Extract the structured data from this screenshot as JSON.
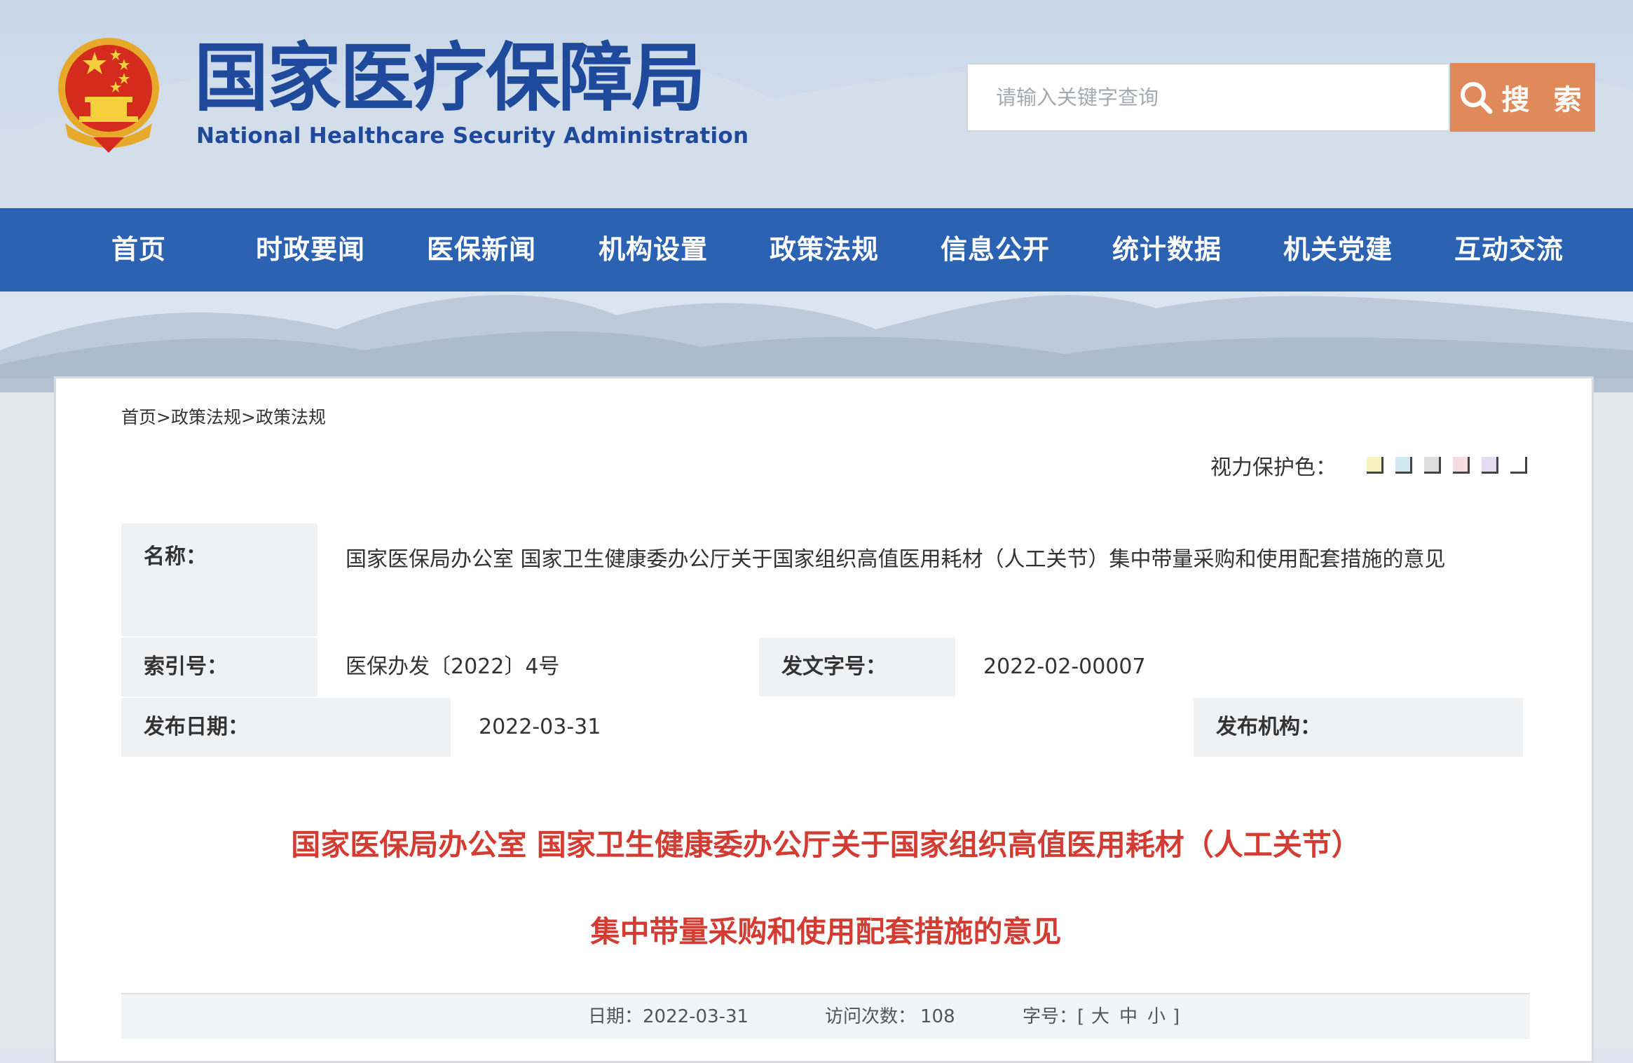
{
  "header": {
    "title_cn": "国家医疗保障局",
    "title_en": "National Healthcare Security Administration",
    "search_placeholder": "请输入关键字查询",
    "search_button": "搜 索"
  },
  "nav": [
    "首页",
    "时政要闻",
    "医保新闻",
    "机构设置",
    "政策法规",
    "信息公开",
    "统计数据",
    "机关党建",
    "互动交流"
  ],
  "breadcrumb": [
    "首页",
    "政策法规",
    "政策法规"
  ],
  "breadcrumb_sep": ">",
  "eye_protect": {
    "label": "视力保护色：",
    "colors": [
      "#f7f3c0",
      "#cfe8f2",
      "#dedede",
      "#f5dde2",
      "#e6dcf2",
      "#ffffff"
    ]
  },
  "info": {
    "name_label": "名称：",
    "name_value": "国家医保局办公室 国家卫生健康委办公厅关于国家组织高值医用耗材（人工关节）集中带量采购和使用配套措施的意见",
    "index_label": "索引号：",
    "index_value": "医保办发〔2022〕4号",
    "doc_no_label": "发文字号：",
    "doc_no_value": "2022-02-00007",
    "date_label": "发布日期：",
    "date_value": "2022-03-31",
    "org_label": "发布机构：",
    "org_value": ""
  },
  "doc_title": {
    "line1": "国家医保局办公室 国家卫生健康委办公厅关于国家组织高值医用耗材（人工关节）",
    "line2": "集中带量采购和使用配套措施的意见"
  },
  "meta": {
    "date_label": "日期：",
    "date_value": "2022-03-31",
    "visits_label": "访问次数：",
    "visits_value": "108",
    "font_label": "字号：",
    "bracket_open": "[",
    "size_large": "大",
    "size_medium": "中",
    "size_small": "小",
    "bracket_close": "]"
  },
  "colors": {
    "nav_bg": "#2c62b2",
    "logo_text": "#1f4a9b",
    "search_button": "#e0895a",
    "title_red": "#d33c33"
  },
  "icons": [
    "national-emblem-icon",
    "search-icon"
  ]
}
